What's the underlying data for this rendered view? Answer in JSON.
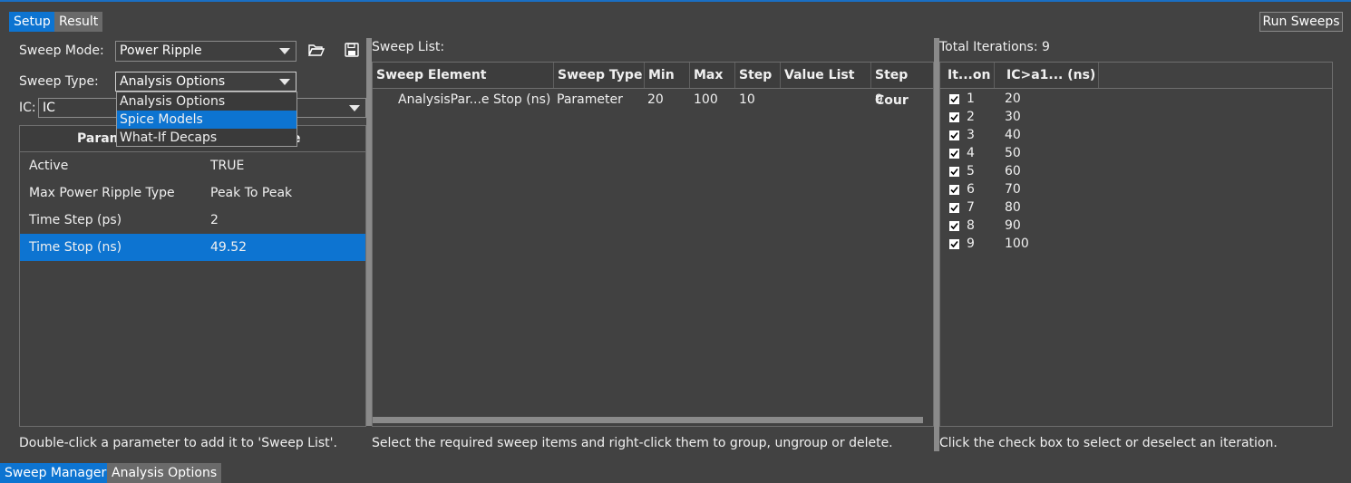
{
  "top_tabs": [
    {
      "label": "Setup"
    },
    {
      "label": "Result"
    }
  ],
  "run_sweeps_label": "Run Sweeps",
  "left": {
    "sweep_mode_label": "Sweep Mode:",
    "sweep_mode_value": "Power Ripple",
    "sweep_type_label": "Sweep Type:",
    "sweep_type_value": "Analysis Options",
    "sweep_type_options": [
      {
        "label": "Analysis Options"
      },
      {
        "label": "Spice Models"
      },
      {
        "label": "What-If Decaps"
      }
    ],
    "ic_label": "IC:",
    "ic_value": "IC",
    "params_header_visible": "Param",
    "params_header_trail": "e",
    "params": [
      {
        "name": "Active",
        "value": "TRUE"
      },
      {
        "name": "Max Power Ripple Type",
        "value": "Peak To Peak"
      },
      {
        "name": "Time Step (ps)",
        "value": "2"
      },
      {
        "name": "Time Stop (ns)",
        "value": "49.52"
      }
    ],
    "hint": "Double-click a parameter to add it to 'Sweep List'."
  },
  "middle": {
    "title": "Sweep List:",
    "columns": [
      {
        "label": "Sweep Element"
      },
      {
        "label": "Sweep Type"
      },
      {
        "label": "Min"
      },
      {
        "label": "Max"
      },
      {
        "label": "Step"
      },
      {
        "label": "Value List"
      },
      {
        "label": "Step Cour"
      }
    ],
    "rows": [
      {
        "element": "AnalysisPar...e Stop (ns)",
        "type": "Parameter",
        "min": "20",
        "max": "100",
        "step": "10",
        "value_list": "",
        "step_count": "9"
      }
    ],
    "hint": "Select the required sweep items and right-click them to group, ungroup or delete."
  },
  "right": {
    "title": "Total Iterations: 9",
    "columns": [
      {
        "label": "It...on"
      },
      {
        "label": "IC>a1... (ns)"
      }
    ],
    "iterations": [
      {
        "n": "1",
        "value": "20"
      },
      {
        "n": "2",
        "value": "30"
      },
      {
        "n": "3",
        "value": "40"
      },
      {
        "n": "4",
        "value": "50"
      },
      {
        "n": "5",
        "value": "60"
      },
      {
        "n": "6",
        "value": "70"
      },
      {
        "n": "7",
        "value": "80"
      },
      {
        "n": "8",
        "value": "90"
      },
      {
        "n": "9",
        "value": "100"
      }
    ],
    "hint": "Click the check box to select or deselect an iteration."
  },
  "bottom_tabs": [
    {
      "label": "Sweep Manager"
    },
    {
      "label": "Analysis Options"
    }
  ],
  "colors": {
    "accent": "#0d74d1",
    "background": "#424242"
  }
}
